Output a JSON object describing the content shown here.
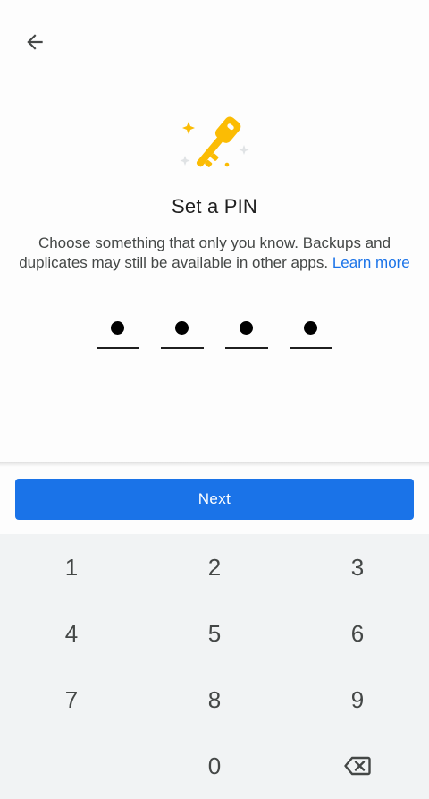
{
  "header": {
    "back_icon": "arrow-left-icon"
  },
  "hero": {
    "icon": "key-icon",
    "accent_color": "#fbbc04"
  },
  "title": "Set a PIN",
  "description": {
    "text": "Choose something that only you know. Backups and duplicates may still be available in other apps.",
    "link": "Learn more",
    "link_color": "#1a73e8"
  },
  "pin": {
    "length": 4,
    "entered": 4
  },
  "next_button": {
    "label": "Next",
    "color": "#1a73e8"
  },
  "keypad": {
    "keys": [
      "1",
      "2",
      "3",
      "4",
      "5",
      "6",
      "7",
      "8",
      "9",
      "0"
    ],
    "backspace_icon": "backspace-icon"
  }
}
